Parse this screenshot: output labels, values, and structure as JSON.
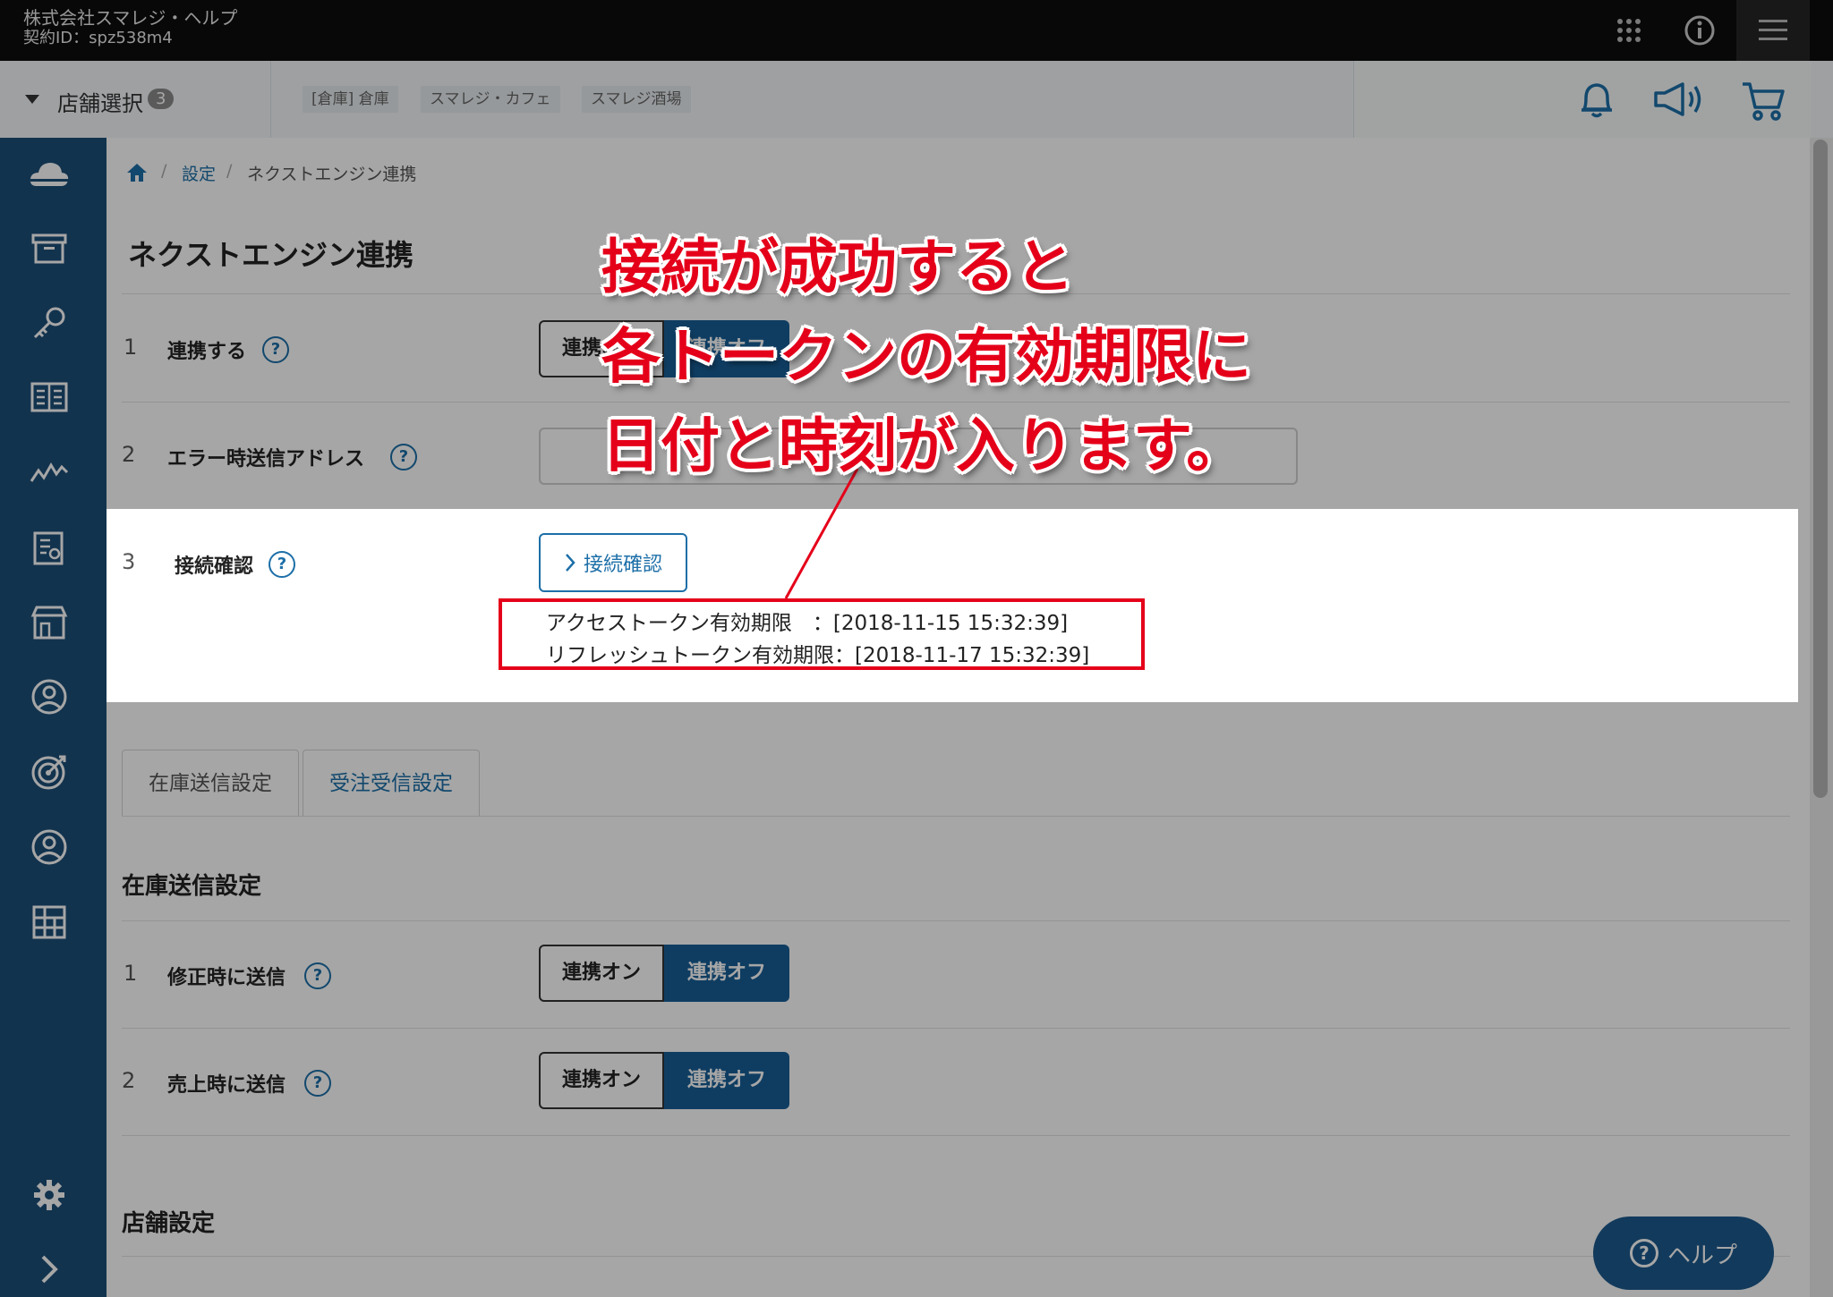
{
  "header": {
    "company": "株式会社スマレジ・ヘルプ",
    "contract_id": "契約ID：spz538m4"
  },
  "store_bar": {
    "select_label": "店舗選択",
    "count": "3",
    "stores": [
      "[倉庫] 倉庫",
      "スマレジ・カフェ",
      "スマレジ酒場"
    ]
  },
  "breadcrumb": {
    "sep": "/",
    "settings": "設定",
    "current": "ネクストエンジン連携"
  },
  "page": {
    "title": "ネクストエンジン連携",
    "help_mark": "?",
    "row1": {
      "num": "1",
      "label": "連携する",
      "on": "連携オン",
      "off": "連携オフ"
    },
    "row2": {
      "num": "2",
      "label": "エラー時送信アドレス",
      "value": ""
    },
    "row3": {
      "num": "3",
      "label": "接続確認",
      "button": "接続確認",
      "access_token": "アクセストークン有効期限　：[2018-11-15 15:32:39]",
      "refresh_token": "リフレッシュトークン有効期限：[2018-11-17 15:32:39]"
    },
    "tabs": [
      "在庫送信設定",
      "受注受信設定"
    ],
    "stock_section": {
      "title": "在庫送信設定",
      "rows": [
        {
          "num": "1",
          "label": "修正時に送信",
          "on": "連携オン",
          "off": "連携オフ"
        },
        {
          "num": "2",
          "label": "売上時に送信",
          "on": "連携オン",
          "off": "連携オフ"
        }
      ]
    },
    "store_section_title": "店舗設定"
  },
  "help_button": "ヘルプ",
  "annotation": {
    "line1": "接続が成功すると",
    "line2": "各トークンの有効期限に",
    "line3": "日付と時刻が入ります。"
  },
  "colors": {
    "sidebar": "#1d4f79",
    "accent": "#175f97",
    "highlight": "#e5001a"
  }
}
